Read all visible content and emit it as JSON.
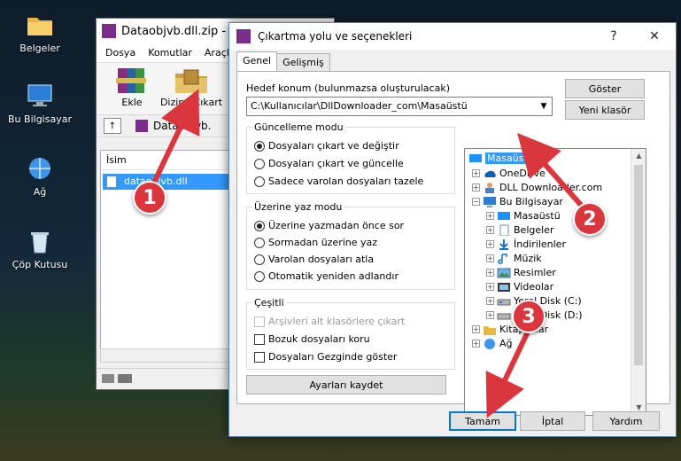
{
  "desktop": {
    "icons": [
      {
        "label": "Belgeler"
      },
      {
        "label": "Bu Bilgisayar"
      },
      {
        "label": "Ağ"
      },
      {
        "label": "Çöp Kutusu"
      }
    ]
  },
  "winrar": {
    "title": "Dataobjvb.dll.zip - W",
    "menu": [
      "Dosya",
      "Komutlar",
      "Araçla"
    ],
    "toolbar": {
      "add": "Ekle",
      "extract": "Dizine Çıkart"
    },
    "address": "Dataobjvb.",
    "list_header": "İsim",
    "file": "dataobjvb.dll"
  },
  "dialog": {
    "title": "Çıkartma yolu ve seçenekleri",
    "help_glyph": "?",
    "close_glyph": "✕",
    "tabs": [
      "Genel",
      "Gelişmiş"
    ],
    "dest_label": "Hedef konum (bulunmazsa oluşturulacak)",
    "dest_value": "C:\\Kullanıcılar\\DllDownloader_com\\Masaüstü",
    "show_button": "Göster",
    "new_folder_button": "Yeni klasör",
    "update_mode": {
      "title": "Güncelleme modu",
      "options": [
        "Dosyaları çıkart ve değiştir",
        "Dosyaları çıkart ve güncelle",
        "Sadece varolan dosyaları tazele"
      ],
      "selected": 0
    },
    "overwrite_mode": {
      "title": "Üzerine yaz modu",
      "options": [
        "Üzerine yazmadan önce sor",
        "Sormadan üzerine yaz",
        "Varolan dosyaları atla",
        "Otomatik yeniden adlandır"
      ],
      "selected": 0
    },
    "misc": {
      "title": "Çeşitli",
      "options": [
        "Arşivleri alt klasörlere çıkart",
        "Bozuk dosyaları koru",
        "Dosyaları Gezginde göster"
      ]
    },
    "save_button": "Ayarları kaydet",
    "tree": [
      {
        "label": "Masaüstü",
        "level": 0,
        "selected": true,
        "icon": "desktop-icon"
      },
      {
        "label": "OneDrive",
        "level": 1,
        "icon": "cloud-icon"
      },
      {
        "label": "DLL Downloader.com",
        "level": 1,
        "icon": "user-icon"
      },
      {
        "label": "Bu Bilgisayar",
        "level": 1,
        "icon": "computer-icon",
        "expanded": true
      },
      {
        "label": "Masaüstü",
        "level": 2,
        "icon": "desktop-icon"
      },
      {
        "label": "Belgeler",
        "level": 2,
        "icon": "document-icon"
      },
      {
        "label": "İndirilenler",
        "level": 2,
        "icon": "download-icon"
      },
      {
        "label": "Müzik",
        "level": 2,
        "icon": "music-icon"
      },
      {
        "label": "Resimler",
        "level": 2,
        "icon": "pictures-icon"
      },
      {
        "label": "Videolar",
        "level": 2,
        "icon": "video-icon"
      },
      {
        "label": "Yerel Disk (C:)",
        "level": 2,
        "icon": "drive-icon"
      },
      {
        "label": "Yerel Disk (D:)",
        "level": 2,
        "icon": "drive-icon"
      },
      {
        "label": "Kitaplıklar",
        "level": 1,
        "icon": "folder-icon"
      },
      {
        "label": "Ağ",
        "level": 1,
        "icon": "network-icon"
      }
    ],
    "ok_button": "Tamam",
    "cancel_button": "İptal",
    "help_button": "Yardım"
  },
  "markers": [
    "1",
    "2",
    "3"
  ],
  "colors": {
    "marker": "#d9363e",
    "selection": "#3399ff",
    "accent": "#0078d7"
  }
}
